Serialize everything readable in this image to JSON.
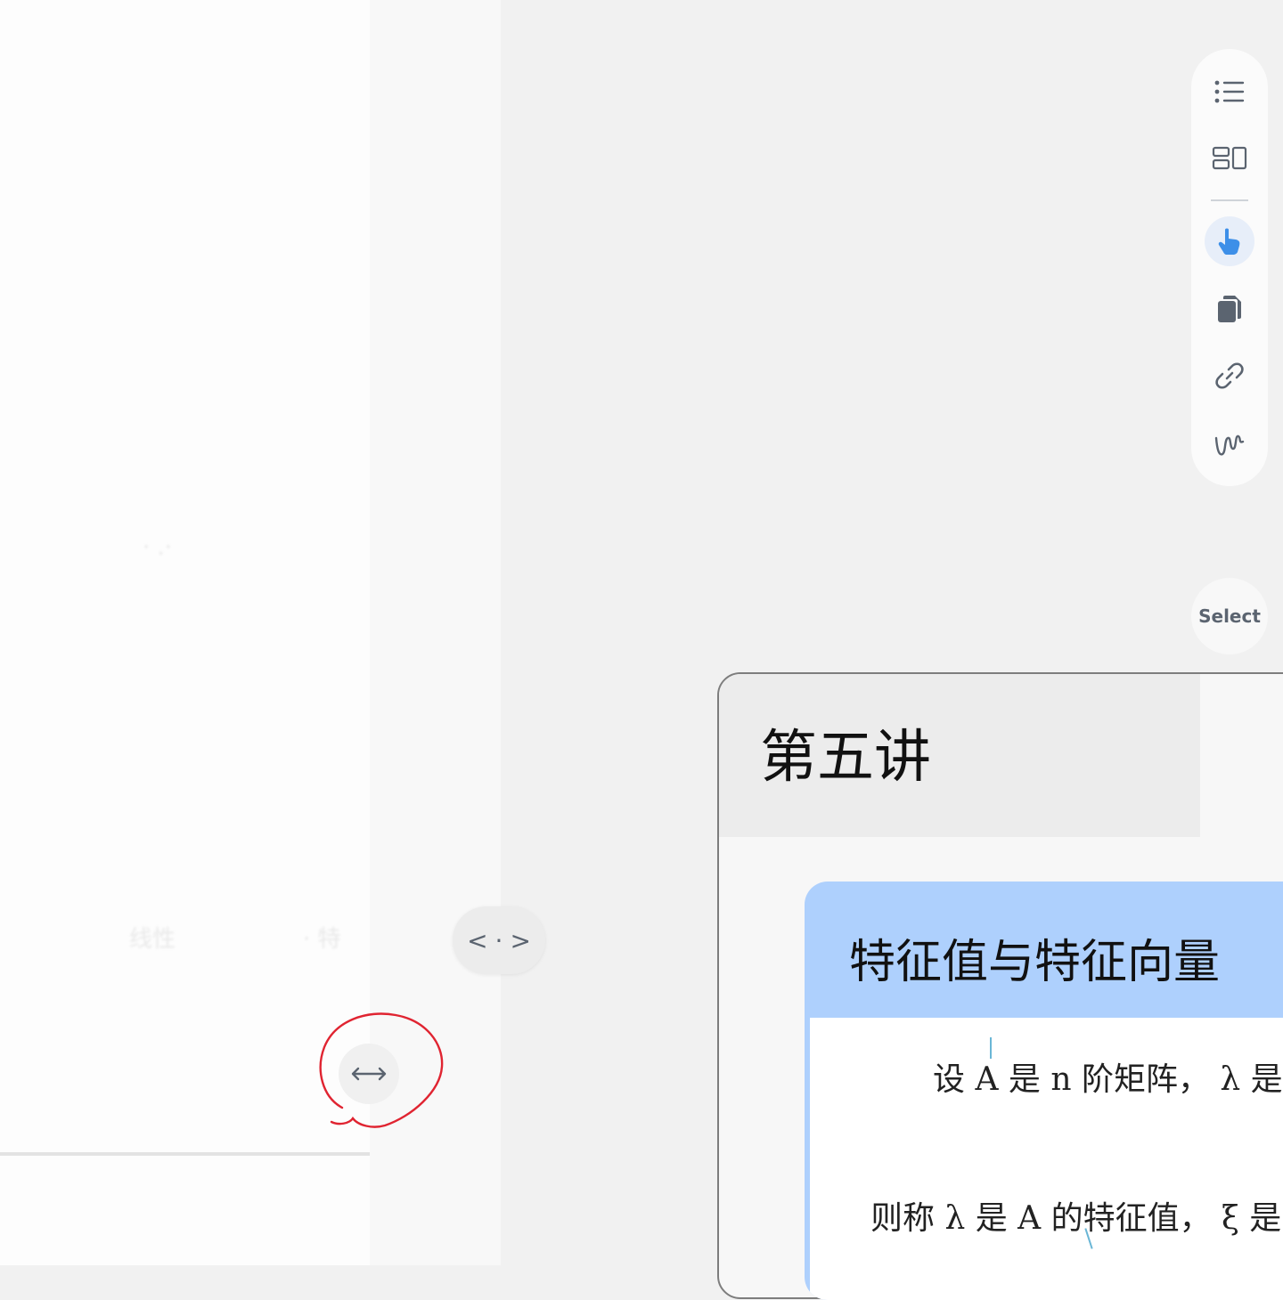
{
  "left_pane": {
    "ghost_text": [
      "· .·",
      "线性",
      "· 特"
    ]
  },
  "split_control": {
    "left_glyph": "<",
    "dot": "·",
    "right_glyph": ">"
  },
  "toolbar": {
    "icons": [
      "list-icon",
      "layout-icon",
      "pointer-hand-icon",
      "copy-icon",
      "link-icon",
      "scribble-icon"
    ],
    "active_tool": "pointer-hand-icon",
    "accent": "#3d8fe8"
  },
  "select_badge": {
    "label": "Select"
  },
  "slide": {
    "title": "第五讲",
    "card": {
      "title": "特征值与特征向量",
      "line1": "设 A 是 n 阶矩阵， λ 是一个",
      "line2": "则称 λ 是 A 的特征值， ξ 是 A 的"
    }
  },
  "colors": {
    "annotation": "#e02431",
    "card_header": "#aed0fd"
  }
}
